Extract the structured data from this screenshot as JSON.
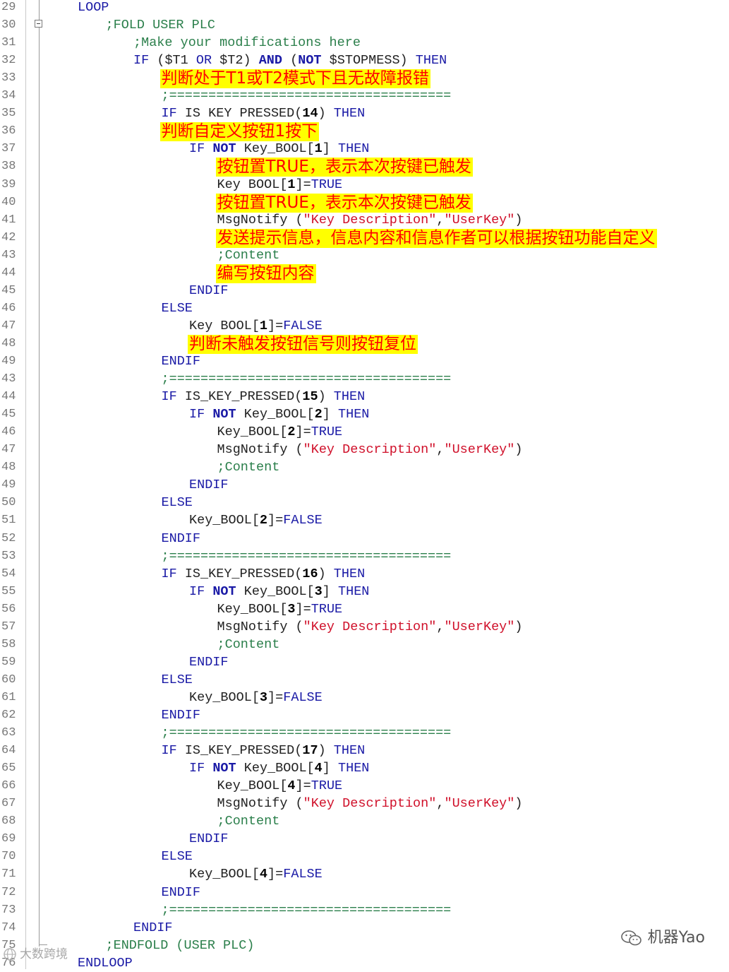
{
  "editor": {
    "lines": [
      {
        "ln": "29",
        "indent": 0,
        "tokens": [
          {
            "t": "LOOP",
            "c": "kw"
          }
        ]
      },
      {
        "ln": "30",
        "indent": 1,
        "tokens": [
          {
            "t": ";FOLD USER PLC",
            "c": "com"
          }
        ]
      },
      {
        "ln": "31",
        "indent": 2,
        "tokens": [
          {
            "t": ";Make your modifications here",
            "c": "com"
          }
        ]
      },
      {
        "ln": "32",
        "indent": 2,
        "tokens": [
          {
            "t": "IF",
            "c": "kw"
          },
          {
            "t": " (",
            "c": "id"
          },
          {
            "t": "$T1",
            "c": "id"
          },
          {
            "t": " OR ",
            "c": "kw"
          },
          {
            "t": "$T2)",
            "c": "id"
          },
          {
            "t": " AND ",
            "c": "kwb"
          },
          {
            "t": "(",
            "c": "id"
          },
          {
            "t": "NOT",
            "c": "kwb"
          },
          {
            "t": " $STOPMESS)",
            "c": "id"
          },
          {
            "t": " THEN",
            "c": "kw"
          }
        ]
      },
      {
        "ln": "33",
        "indent": 3,
        "anno": "判断处于T1或T2模式下且无故障报错"
      },
      {
        "ln": "34",
        "indent": 3,
        "tokens": [
          {
            "t": ";====================================",
            "c": "com"
          }
        ]
      },
      {
        "ln": "35",
        "indent": 3,
        "tokens": [
          {
            "t": "IF",
            "c": "kw"
          },
          {
            "t": " IS KEY PRESSED(",
            "c": "id"
          },
          {
            "t": "14",
            "c": "num"
          },
          {
            "t": ")",
            "c": "id"
          },
          {
            "t": " THEN",
            "c": "kw"
          }
        ]
      },
      {
        "ln": "36",
        "indent": 3,
        "anno": "判断自定义按钮1按下"
      },
      {
        "ln": "37",
        "indent": 4,
        "tokens": [
          {
            "t": "IF",
            "c": "kw"
          },
          {
            "t": " NOT",
            "c": "kwb"
          },
          {
            "t": " Key_BOOL[",
            "c": "id"
          },
          {
            "t": "1",
            "c": "num"
          },
          {
            "t": "]",
            "c": "id"
          },
          {
            "t": " THEN",
            "c": "kw"
          }
        ]
      },
      {
        "ln": "38",
        "indent": 5,
        "anno": "按钮置TRUE，表示本次按键已触发"
      },
      {
        "ln": "39",
        "indent": 5,
        "tokens": [
          {
            "t": "Key BOOL[",
            "c": "id"
          },
          {
            "t": "1",
            "c": "num"
          },
          {
            "t": "]=",
            "c": "id"
          },
          {
            "t": "TRUE",
            "c": "bool"
          }
        ]
      },
      {
        "ln": "40",
        "indent": 5,
        "anno": "按钮置TRUE，表示本次按键已触发"
      },
      {
        "ln": "41",
        "indent": 5,
        "tokens": [
          {
            "t": "MsgNotify (",
            "c": "id"
          },
          {
            "t": "\"Key Description\"",
            "c": "str"
          },
          {
            "t": ",",
            "c": "id"
          },
          {
            "t": "\"UserKey\"",
            "c": "str"
          },
          {
            "t": ")",
            "c": "id"
          }
        ]
      },
      {
        "ln": "42",
        "indent": 5,
        "anno": "发送提示信息，信息内容和信息作者可以根据按钮功能自定义"
      },
      {
        "ln": "43",
        "indent": 5,
        "tokens": [
          {
            "t": ";Content",
            "c": "com"
          }
        ]
      },
      {
        "ln": "44",
        "indent": 5,
        "anno": "编写按钮内容"
      },
      {
        "ln": "45",
        "indent": 4,
        "tokens": [
          {
            "t": "ENDIF",
            "c": "kw"
          }
        ]
      },
      {
        "ln": "46",
        "indent": 3,
        "tokens": [
          {
            "t": "ELSE",
            "c": "kw"
          }
        ]
      },
      {
        "ln": "47",
        "indent": 4,
        "tokens": [
          {
            "t": "Key BOOL[",
            "c": "id"
          },
          {
            "t": "1",
            "c": "num"
          },
          {
            "t": "]=",
            "c": "id"
          },
          {
            "t": "FALSE",
            "c": "bool"
          }
        ]
      },
      {
        "ln": "48",
        "indent": 4,
        "anno": "判断未触发按钮信号则按钮复位"
      },
      {
        "ln": "49",
        "indent": 3,
        "tokens": [
          {
            "t": "ENDIF",
            "c": "kw"
          }
        ]
      },
      {
        "ln": "43",
        "indent": 3,
        "tokens": [
          {
            "t": ";====================================",
            "c": "com"
          }
        ]
      },
      {
        "ln": "44",
        "indent": 3,
        "tokens": [
          {
            "t": "IF",
            "c": "kw"
          },
          {
            "t": " IS_KEY_PRESSED(",
            "c": "id"
          },
          {
            "t": "15",
            "c": "num"
          },
          {
            "t": ")",
            "c": "id"
          },
          {
            "t": " THEN",
            "c": "kw"
          }
        ]
      },
      {
        "ln": "45",
        "indent": 4,
        "tokens": [
          {
            "t": "IF",
            "c": "kw"
          },
          {
            "t": " NOT",
            "c": "kwb"
          },
          {
            "t": " Key_BOOL[",
            "c": "id"
          },
          {
            "t": "2",
            "c": "num"
          },
          {
            "t": "]",
            "c": "id"
          },
          {
            "t": " THEN",
            "c": "kw"
          }
        ]
      },
      {
        "ln": "46",
        "indent": 5,
        "tokens": [
          {
            "t": "Key_BOOL[",
            "c": "id"
          },
          {
            "t": "2",
            "c": "num"
          },
          {
            "t": "]=",
            "c": "id"
          },
          {
            "t": "TRUE",
            "c": "bool"
          }
        ]
      },
      {
        "ln": "47",
        "indent": 5,
        "tokens": [
          {
            "t": "MsgNotify (",
            "c": "id"
          },
          {
            "t": "\"Key Description\"",
            "c": "str"
          },
          {
            "t": ",",
            "c": "id"
          },
          {
            "t": "\"UserKey\"",
            "c": "str"
          },
          {
            "t": ")",
            "c": "id"
          }
        ]
      },
      {
        "ln": "48",
        "indent": 5,
        "tokens": [
          {
            "t": ";Content",
            "c": "com"
          }
        ]
      },
      {
        "ln": "49",
        "indent": 4,
        "tokens": [
          {
            "t": "ENDIF",
            "c": "kw"
          }
        ]
      },
      {
        "ln": "50",
        "indent": 3,
        "tokens": [
          {
            "t": "ELSE",
            "c": "kw"
          }
        ]
      },
      {
        "ln": "51",
        "indent": 4,
        "tokens": [
          {
            "t": "Key_BOOL[",
            "c": "id"
          },
          {
            "t": "2",
            "c": "num"
          },
          {
            "t": "]=",
            "c": "id"
          },
          {
            "t": "FALSE",
            "c": "bool"
          }
        ]
      },
      {
        "ln": "52",
        "indent": 3,
        "tokens": [
          {
            "t": "ENDIF",
            "c": "kw"
          }
        ]
      },
      {
        "ln": "53",
        "indent": 3,
        "tokens": [
          {
            "t": ";====================================",
            "c": "com"
          }
        ]
      },
      {
        "ln": "54",
        "indent": 3,
        "tokens": [
          {
            "t": "IF",
            "c": "kw"
          },
          {
            "t": " IS_KEY_PRESSED(",
            "c": "id"
          },
          {
            "t": "16",
            "c": "num"
          },
          {
            "t": ")",
            "c": "id"
          },
          {
            "t": " THEN",
            "c": "kw"
          }
        ]
      },
      {
        "ln": "55",
        "indent": 4,
        "tokens": [
          {
            "t": "IF",
            "c": "kw"
          },
          {
            "t": " NOT",
            "c": "kwb"
          },
          {
            "t": " Key_BOOL[",
            "c": "id"
          },
          {
            "t": "3",
            "c": "num"
          },
          {
            "t": "]",
            "c": "id"
          },
          {
            "t": " THEN",
            "c": "kw"
          }
        ]
      },
      {
        "ln": "56",
        "indent": 5,
        "tokens": [
          {
            "t": "Key_BOOL[",
            "c": "id"
          },
          {
            "t": "3",
            "c": "num"
          },
          {
            "t": "]=",
            "c": "id"
          },
          {
            "t": "TRUE",
            "c": "bool"
          }
        ]
      },
      {
        "ln": "57",
        "indent": 5,
        "tokens": [
          {
            "t": "MsgNotify (",
            "c": "id"
          },
          {
            "t": "\"Key Description\"",
            "c": "str"
          },
          {
            "t": ",",
            "c": "id"
          },
          {
            "t": "\"UserKey\"",
            "c": "str"
          },
          {
            "t": ")",
            "c": "id"
          }
        ]
      },
      {
        "ln": "58",
        "indent": 5,
        "tokens": [
          {
            "t": ";Content",
            "c": "com"
          }
        ]
      },
      {
        "ln": "59",
        "indent": 4,
        "tokens": [
          {
            "t": "ENDIF",
            "c": "kw"
          }
        ]
      },
      {
        "ln": "60",
        "indent": 3,
        "tokens": [
          {
            "t": "ELSE",
            "c": "kw"
          }
        ]
      },
      {
        "ln": "61",
        "indent": 4,
        "tokens": [
          {
            "t": "Key_BOOL[",
            "c": "id"
          },
          {
            "t": "3",
            "c": "num"
          },
          {
            "t": "]=",
            "c": "id"
          },
          {
            "t": "FALSE",
            "c": "bool"
          }
        ]
      },
      {
        "ln": "62",
        "indent": 3,
        "tokens": [
          {
            "t": "ENDIF",
            "c": "kw"
          }
        ]
      },
      {
        "ln": "63",
        "indent": 3,
        "tokens": [
          {
            "t": ";====================================",
            "c": "com"
          }
        ]
      },
      {
        "ln": "64",
        "indent": 3,
        "tokens": [
          {
            "t": "IF",
            "c": "kw"
          },
          {
            "t": " IS_KEY_PRESSED(",
            "c": "id"
          },
          {
            "t": "17",
            "c": "num"
          },
          {
            "t": ")",
            "c": "id"
          },
          {
            "t": " THEN",
            "c": "kw"
          }
        ]
      },
      {
        "ln": "65",
        "indent": 4,
        "tokens": [
          {
            "t": "IF",
            "c": "kw"
          },
          {
            "t": " NOT",
            "c": "kwb"
          },
          {
            "t": " Key_BOOL[",
            "c": "id"
          },
          {
            "t": "4",
            "c": "num"
          },
          {
            "t": "]",
            "c": "id"
          },
          {
            "t": " THEN",
            "c": "kw"
          }
        ]
      },
      {
        "ln": "66",
        "indent": 5,
        "tokens": [
          {
            "t": "Key_BOOL[",
            "c": "id"
          },
          {
            "t": "4",
            "c": "num"
          },
          {
            "t": "]=",
            "c": "id"
          },
          {
            "t": "TRUE",
            "c": "bool"
          }
        ]
      },
      {
        "ln": "67",
        "indent": 5,
        "tokens": [
          {
            "t": "MsgNotify (",
            "c": "id"
          },
          {
            "t": "\"Key Description\"",
            "c": "str"
          },
          {
            "t": ",",
            "c": "id"
          },
          {
            "t": "\"UserKey\"",
            "c": "str"
          },
          {
            "t": ")",
            "c": "id"
          }
        ]
      },
      {
        "ln": "68",
        "indent": 5,
        "tokens": [
          {
            "t": ";Content",
            "c": "com"
          }
        ]
      },
      {
        "ln": "69",
        "indent": 4,
        "tokens": [
          {
            "t": "ENDIF",
            "c": "kw"
          }
        ]
      },
      {
        "ln": "70",
        "indent": 3,
        "tokens": [
          {
            "t": "ELSE",
            "c": "kw"
          }
        ]
      },
      {
        "ln": "71",
        "indent": 4,
        "tokens": [
          {
            "t": "Key_BOOL[",
            "c": "id"
          },
          {
            "t": "4",
            "c": "num"
          },
          {
            "t": "]=",
            "c": "id"
          },
          {
            "t": "FALSE",
            "c": "bool"
          }
        ]
      },
      {
        "ln": "72",
        "indent": 3,
        "tokens": [
          {
            "t": "ENDIF",
            "c": "kw"
          }
        ]
      },
      {
        "ln": "73",
        "indent": 3,
        "tokens": [
          {
            "t": ";====================================",
            "c": "com"
          }
        ]
      },
      {
        "ln": "74",
        "indent": 2,
        "tokens": [
          {
            "t": "ENDIF",
            "c": "kw"
          }
        ]
      },
      {
        "ln": "75",
        "indent": 1,
        "tokens": [
          {
            "t": ";ENDFOLD (USER PLC)",
            "c": "com"
          }
        ]
      },
      {
        "ln": "76",
        "indent": 0,
        "tokens": [
          {
            "t": "ENDLOOP",
            "c": "kw"
          }
        ]
      }
    ]
  },
  "watermarks": {
    "right_text": "机器Yao",
    "left_text": "大数跨境"
  },
  "colors": {
    "keyword": "#1a1aa6",
    "string": "#d0102a",
    "comment": "#2b7f4b",
    "annotation_bg": "#ffff00",
    "annotation_text": "#ff0000"
  }
}
